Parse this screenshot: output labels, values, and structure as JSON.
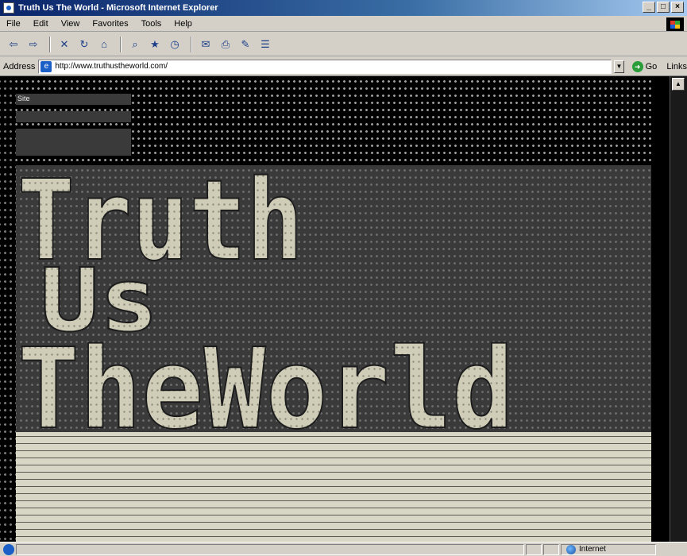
{
  "window": {
    "title": "Truth Us The World - Microsoft Internet Explorer",
    "controls": [
      "_",
      "□",
      "×"
    ]
  },
  "menu": {
    "items": [
      "File",
      "Edit",
      "View",
      "Favorites",
      "Tools",
      "Help"
    ]
  },
  "toolbar": {
    "buttons": [
      {
        "name": "back",
        "glyph": "⇦"
      },
      {
        "name": "forward",
        "glyph": "⇨"
      },
      {
        "name": "stop",
        "glyph": "✕"
      },
      {
        "name": "refresh",
        "glyph": "↻"
      },
      {
        "name": "home",
        "glyph": "⌂"
      },
      {
        "name": "search",
        "glyph": "⌕"
      },
      {
        "name": "favorites",
        "glyph": "★"
      },
      {
        "name": "history",
        "glyph": "◷"
      },
      {
        "name": "mail",
        "glyph": "✉"
      },
      {
        "name": "print",
        "glyph": "⎙"
      },
      {
        "name": "edit",
        "glyph": "✎"
      },
      {
        "name": "discuss",
        "glyph": "☰"
      }
    ]
  },
  "address": {
    "label": "Address",
    "value": "http://www.truthustheworld.com/",
    "go_label": "Go",
    "links_label": "Links"
  },
  "page": {
    "nav_top": "Site",
    "nav_middle": "",
    "nav_bottom_lines": [
      "",
      "",
      ""
    ],
    "hero_lines": [
      "Truth",
      "Us",
      "TheWorld"
    ]
  },
  "status": {
    "zone_label": "Internet"
  },
  "colors": {
    "hero_text": "#cfcdb8",
    "hero_bg": "#3a3a3a",
    "band_bg": "#d8d6c4",
    "dots": "#9c9c9c"
  }
}
